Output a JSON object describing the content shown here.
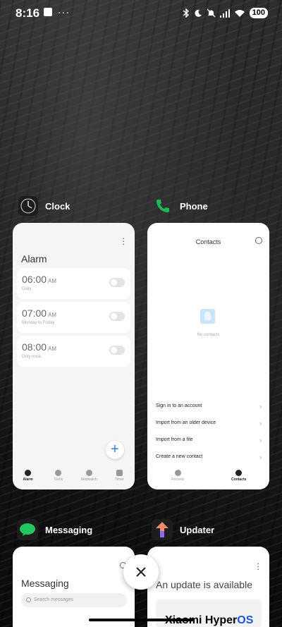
{
  "status_bar": {
    "time": "8:16",
    "battery": "100"
  },
  "apps": {
    "clock": {
      "name": "Clock",
      "title": "Alarm",
      "alarms": [
        {
          "time": "06:00",
          "ampm": "AM",
          "label": "Daily"
        },
        {
          "time": "07:00",
          "ampm": "AM",
          "label": "Monday to Friday"
        },
        {
          "time": "08:00",
          "ampm": "AM",
          "label": "Only once"
        }
      ],
      "tabs": [
        "Alarm",
        "Clock",
        "Stopwatch",
        "Timer"
      ]
    },
    "phone": {
      "name": "Phone",
      "title": "Contacts",
      "empty_text": "No contacts",
      "options": [
        "Sign in to an account",
        "Import from an older device",
        "Import from a file",
        "Create a new contact"
      ],
      "tabs": [
        "Recents",
        "Contacts"
      ]
    },
    "messaging": {
      "name": "Messaging",
      "title": "Messaging",
      "search_placeholder": "Search messages"
    },
    "updater": {
      "name": "Updater",
      "title": "An update is available",
      "brand": "Xiaomi Hyper",
      "brand_accent": "OS"
    }
  },
  "colors": {
    "phone_accent": "#1db954",
    "messaging_accent": "#22c55e",
    "fab_plus": "#2b7df2"
  }
}
